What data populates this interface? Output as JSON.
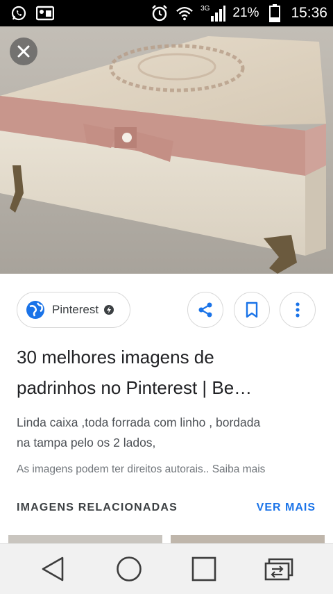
{
  "status_bar": {
    "network": "3G",
    "battery": "21%",
    "time": "15:36",
    "icons": [
      "whatsapp-icon",
      "notification-icon",
      "alarm-icon",
      "wifi-icon",
      "signal-icon",
      "battery-icon"
    ]
  },
  "source": {
    "name": "Pinterest"
  },
  "result": {
    "title_line1": "30 melhores imagens de",
    "title_line2": "padrinhos no Pinterest | Be…",
    "description_line1": "Linda caixa ,toda forrada com linho , bordada",
    "description_line2": "na tampa pelo os 2 lados,",
    "copyright": "As imagens podem ter direitos autorais.. Saiba mais"
  },
  "related": {
    "heading": "IMAGENS RELACIONADAS",
    "see_more": "VER MAIS"
  },
  "colors": {
    "accent": "#1a73e8",
    "status_bar": "#000000",
    "nav_bar": "#f1f1f1"
  }
}
